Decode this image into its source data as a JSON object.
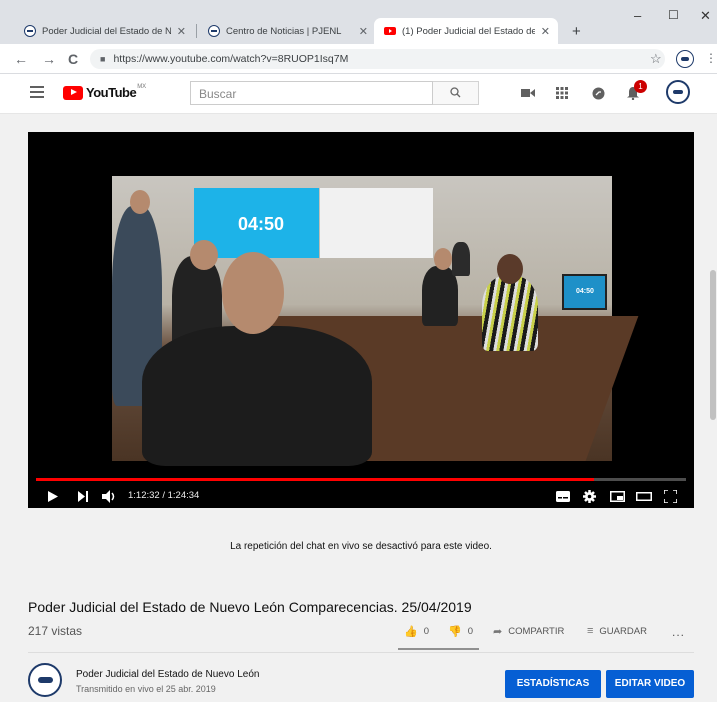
{
  "browser": {
    "tabs": [
      {
        "title": "Poder Judicial del Estado de Nue",
        "active": false
      },
      {
        "title": "Centro de Noticias | PJENL",
        "active": false
      },
      {
        "title": "(1) Poder Judicial del Estado de N",
        "active": true
      }
    ],
    "new_tab": "+",
    "url": "https://www.youtube.com/watch?v=8RUOP1Isq7M",
    "window_controls": {
      "minimize": "–",
      "maximize": "☐",
      "close": "✕"
    },
    "nav": {
      "back": "←",
      "forward": "→",
      "reload": "C"
    }
  },
  "youtube": {
    "logo_text": "YouTube",
    "country": "MX",
    "search_placeholder": "Buscar",
    "notification_count": "1",
    "icons": [
      "menu-icon",
      "search-icon",
      "create-video-icon",
      "apps-icon",
      "messages-icon",
      "notifications-icon",
      "account-avatar"
    ]
  },
  "video": {
    "time": "1:12:32 / 1:24:34",
    "progress": 0.858,
    "screen_clock": "04:50",
    "monitor_clock": "04:50"
  },
  "page": {
    "chat_note": "La repetición del chat en vivo se desactivó para este video.",
    "title": "Poder Judicial del Estado de Nuevo León Comparecencias. 25/04/2019",
    "views": "217 vistas",
    "likes": "0",
    "dislikes": "0",
    "share_label": "COMPARTIR",
    "save_label": "GUARDAR",
    "more": "...",
    "channel_name": "Poder Judicial del Estado de Nuevo León",
    "channel_sub": "Transmitido en vivo el 25 abr. 2019",
    "stats_button": "ESTADÍSTICAS",
    "edit_button": "EDITAR VIDEO"
  },
  "colors": {
    "accent": "#065fd4",
    "brand_red": "#ff0000"
  }
}
